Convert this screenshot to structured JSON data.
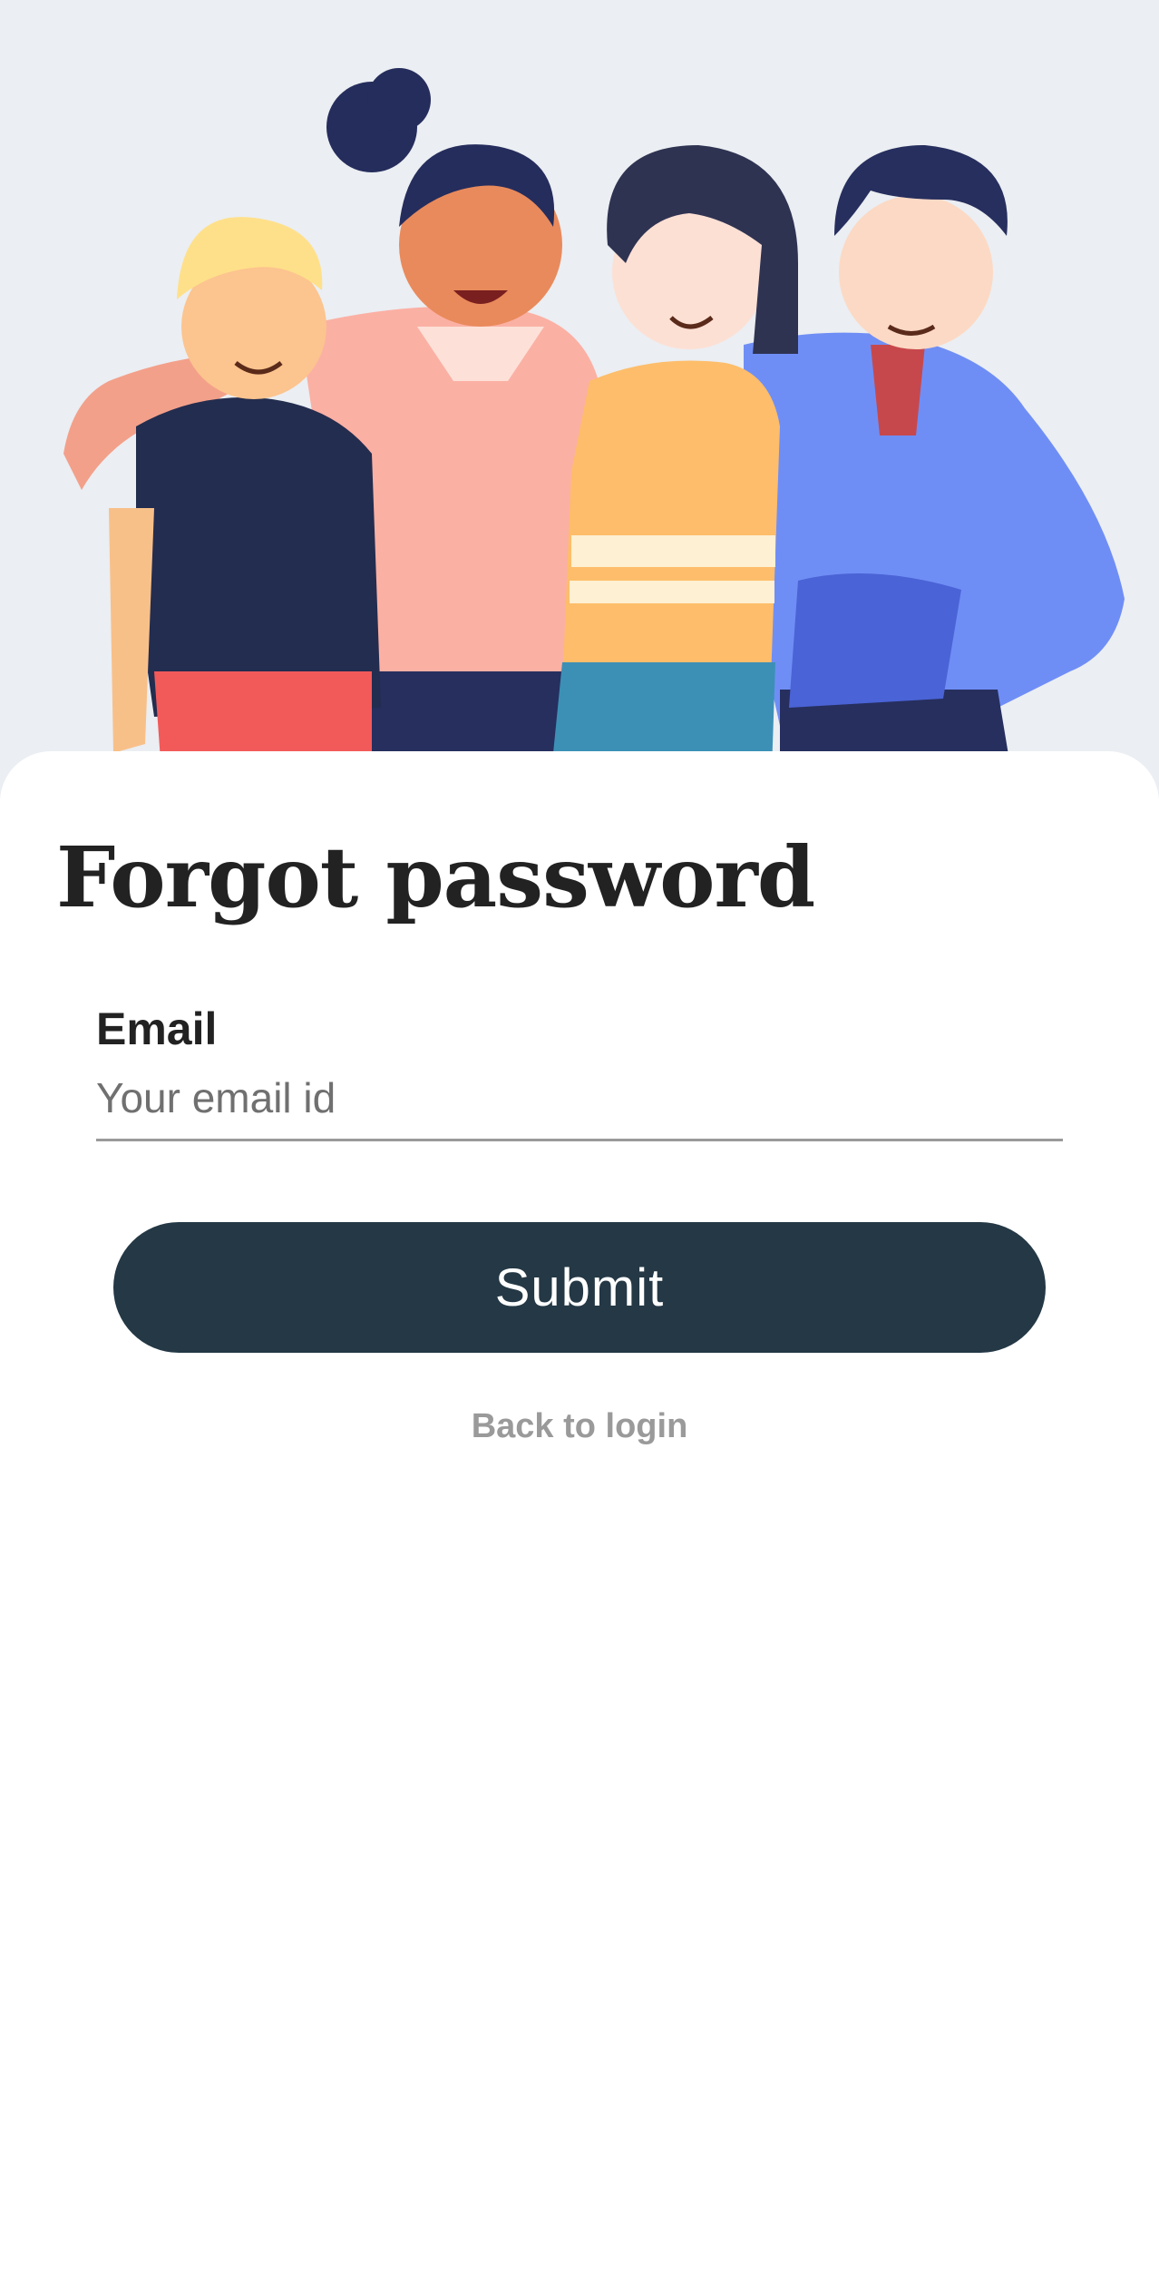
{
  "hero": {
    "illustration": "group-of-friends-illustration",
    "background_color": "#ebeef2"
  },
  "title": "Forgot password",
  "form": {
    "email_label": "Email",
    "email_placeholder": "Your email id",
    "email_value": ""
  },
  "actions": {
    "submit_label": "Submit",
    "back_label": "Back to login"
  },
  "colors": {
    "primary_button": "#243845",
    "title_text": "#222222",
    "muted_text": "#9a9a9a"
  }
}
